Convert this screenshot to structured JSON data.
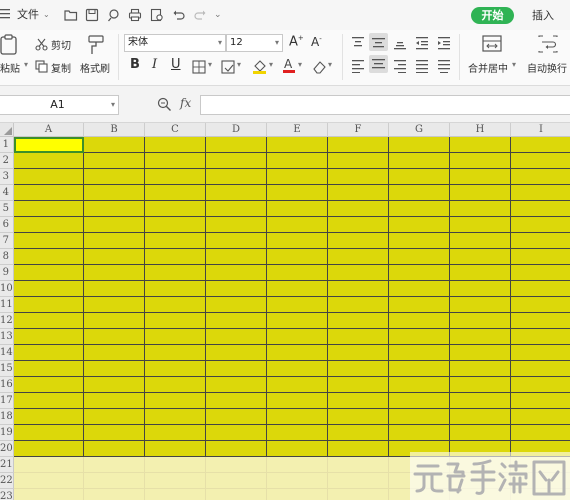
{
  "topbar": {
    "menu_label": "文件",
    "tabs": [
      {
        "label": "开始",
        "active": true
      },
      {
        "label": "插入",
        "active": false
      }
    ]
  },
  "ribbon": {
    "clipboard": {
      "paste": "粘贴",
      "cut": "剪切",
      "copy": "复制",
      "format_painter": "格式刷"
    },
    "font": {
      "name": "宋体",
      "size": "12"
    },
    "merge_center": "合并居中",
    "wrap_text": "自动换行"
  },
  "formula_bar": {
    "cell_ref": "A1",
    "fx": "fx",
    "value": ""
  },
  "sheet": {
    "columns": [
      "A",
      "B",
      "C",
      "D",
      "E",
      "F",
      "G",
      "H",
      "I"
    ],
    "rows": [
      "1",
      "2",
      "3",
      "4",
      "5",
      "6",
      "7",
      "8",
      "9",
      "10",
      "11",
      "12",
      "13",
      "14",
      "15",
      "16",
      "17",
      "18",
      "19",
      "20",
      "21",
      "22",
      "23"
    ],
    "filled_rows": 20,
    "active_cell": "A1",
    "fill_color": "#dcd80a",
    "active_fill": "#ffff00",
    "light_fill": "#f3f0b0"
  },
  "watermark": {
    "text": "元码手游网"
  }
}
